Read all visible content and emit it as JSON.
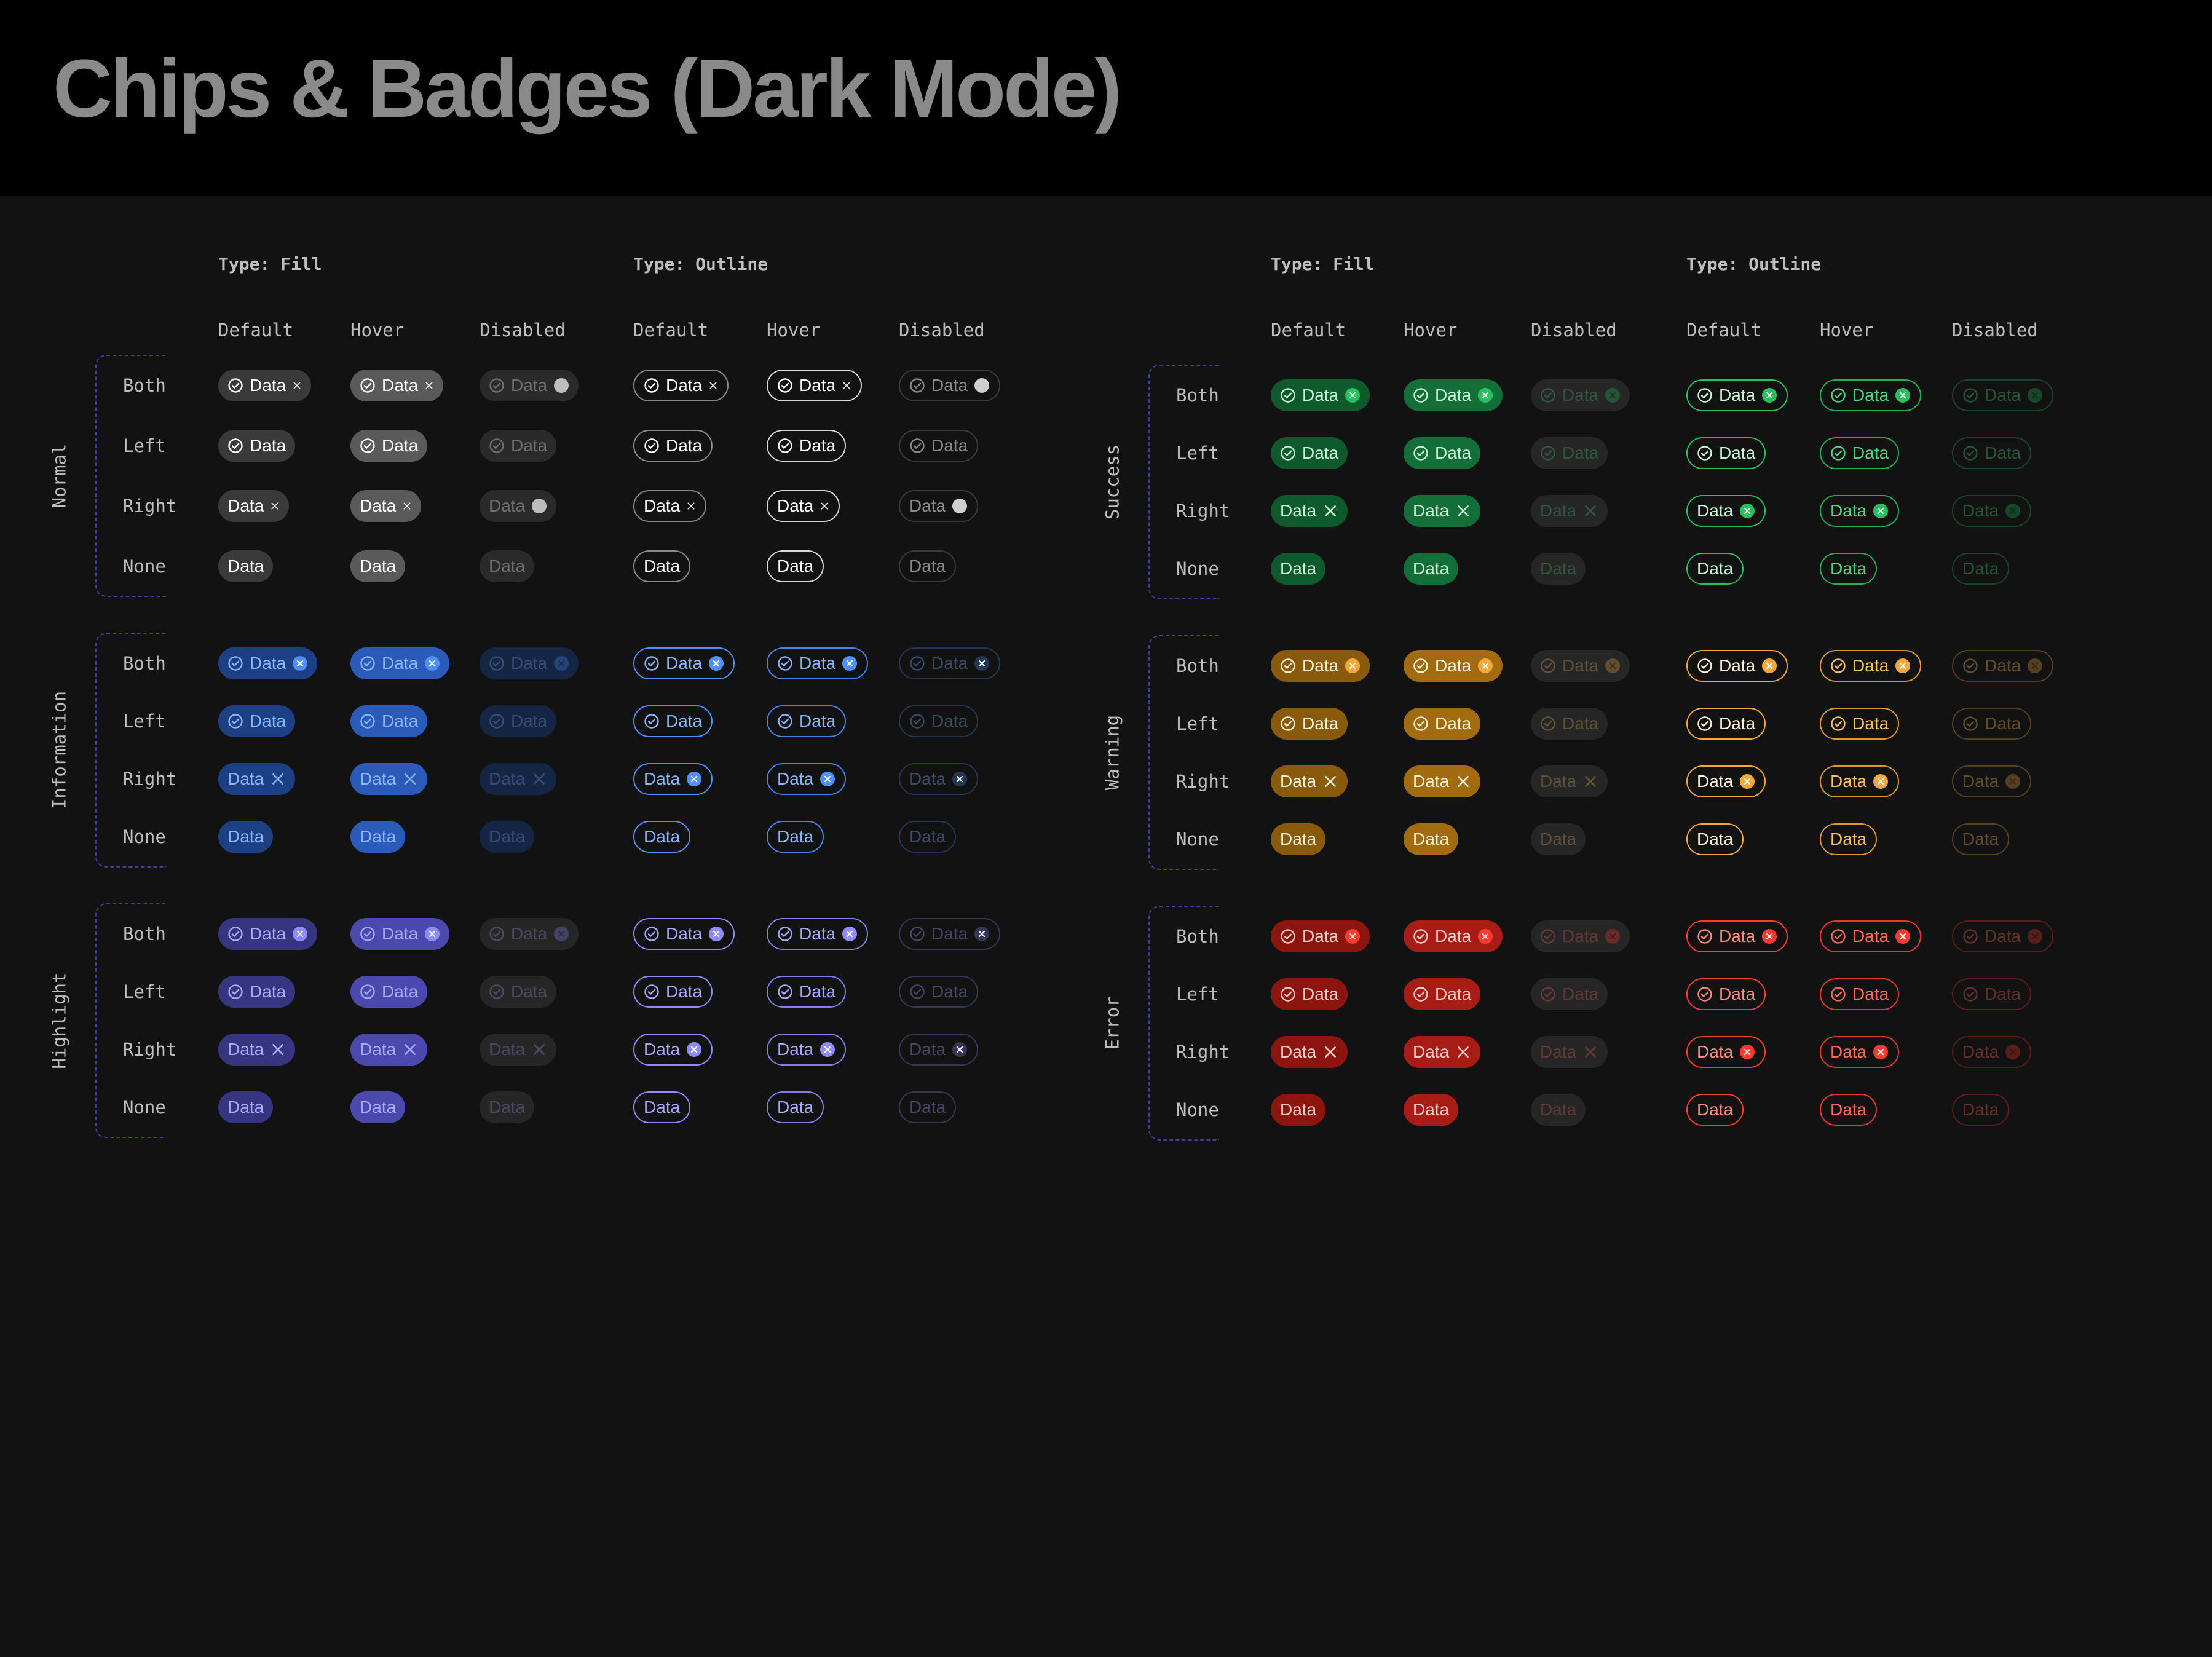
{
  "title": "Chips & Badges (Dark Mode)",
  "icons": {
    "leading": "check-circle-icon",
    "trailing": "close-icon"
  },
  "panels": [
    {
      "id": "left",
      "types": [
        "Type: Fill",
        "Type: Outline"
      ],
      "states": [
        "Default",
        "Hover",
        "Disabled"
      ],
      "groups": [
        {
          "name": "Normal",
          "rows": [
            "Both",
            "Left",
            "Right",
            "None"
          ],
          "colors": {
            "fill": "#3a3a3a",
            "hover": "#5a5a5a",
            "disabled": "#2a2a2a",
            "text": "#ffffff",
            "accent": "#ffffff"
          }
        },
        {
          "name": "Information",
          "rows": [
            "Both",
            "Left",
            "Right",
            "None"
          ],
          "colors": {
            "fill": "#1d3f84",
            "hover": "#2b5bb8",
            "disabled": "#152544",
            "text": "#8ab4ff",
            "accent": "#4f8fff"
          }
        },
        {
          "name": "Highlight",
          "rows": [
            "Both",
            "Left",
            "Right",
            "None"
          ],
          "colors": {
            "fill": "#36357f",
            "hover": "#4b48ae",
            "disabled": "#262626",
            "text": "#a9a7ff",
            "accent": "#8f8bff"
          }
        }
      ]
    },
    {
      "id": "right",
      "types": [
        "Type: Fill",
        "Type: Outline"
      ],
      "states": [
        "Default",
        "Hover",
        "Disabled"
      ],
      "groups": [
        {
          "name": "Success",
          "rows": [
            "Both",
            "Left",
            "Right",
            "None"
          ],
          "colors": {
            "fill": "#0f5a2c",
            "hover": "#146e37",
            "disabled": "#262626",
            "text": "#54d27f",
            "accent": "#27c05c"
          }
        },
        {
          "name": "Warning",
          "rows": [
            "Both",
            "Left",
            "Right",
            "None"
          ],
          "colors": {
            "fill": "#8a5a0c",
            "hover": "#a36b10",
            "disabled": "#262626",
            "text": "#f5c164",
            "accent": "#f2a93b"
          }
        },
        {
          "name": "Error",
          "rows": [
            "Both",
            "Left",
            "Right",
            "None"
          ],
          "colors": {
            "fill": "#8c1510",
            "hover": "#a81c16",
            "disabled": "#262626",
            "text": "#ff6a5a",
            "accent": "#ff3b30"
          }
        }
      ]
    }
  ],
  "chip_label": "Data"
}
